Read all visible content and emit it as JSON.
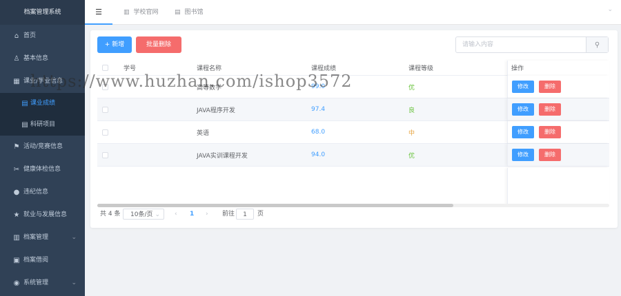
{
  "app": {
    "title": "档案管理系统"
  },
  "sidebar": {
    "items": [
      {
        "icon": "home-icon",
        "glyph": "⌂",
        "label": "首页",
        "chevron": ""
      },
      {
        "icon": "user-icon",
        "glyph": "♙",
        "label": "基本信息",
        "chevron": ""
      },
      {
        "icon": "grid-icon",
        "glyph": "▦",
        "label": "课业/学业信息",
        "chevron": ""
      },
      {
        "icon": "document-icon",
        "glyph": "▤",
        "label": "课业成绩",
        "chevron": "",
        "sub": true,
        "active": true
      },
      {
        "icon": "document-icon",
        "glyph": "▤",
        "label": "科研项目",
        "chevron": "",
        "sub": true
      },
      {
        "icon": "flag-icon",
        "glyph": "⚑",
        "label": "活动/竞赛信息",
        "chevron": ""
      },
      {
        "icon": "scissors-icon",
        "glyph": "✂",
        "label": "健康体检信息",
        "chevron": ""
      },
      {
        "icon": "info-icon",
        "glyph": "●",
        "label": "违纪信息",
        "chevron": ""
      },
      {
        "icon": "star-icon",
        "glyph": "★",
        "label": "就业与发展信息",
        "chevron": ""
      },
      {
        "icon": "chart-icon",
        "glyph": "▥",
        "label": "档案管理",
        "chevron": "⌄"
      },
      {
        "icon": "archive-icon",
        "glyph": "▣",
        "label": "档案借阅",
        "chevron": ""
      },
      {
        "icon": "location-icon",
        "glyph": "◉",
        "label": "系统管理",
        "chevron": "⌄"
      }
    ]
  },
  "header": {
    "menu_glyph": "☰",
    "links": [
      {
        "label": "学校官网",
        "glyph": "▥"
      },
      {
        "label": "图书馆",
        "glyph": "▤"
      }
    ],
    "chevron": "⌄"
  },
  "toolbar": {
    "add_label": "+ 新增",
    "batch_delete_label": "批量删除",
    "search_placeholder": "请输入内容",
    "search_glyph": "⚲"
  },
  "table": {
    "headers": {
      "id": "学号",
      "course": "课程名称",
      "score": "课程成绩",
      "grade": "课程等级",
      "ops": "操作"
    },
    "rows": [
      {
        "id": "",
        "course": "高等数学",
        "score": "99.0",
        "grade": "优",
        "grade_color": "#67c23a"
      },
      {
        "id": "",
        "course": "JAVA程序开发",
        "score": "97.4",
        "grade": "良",
        "grade_color": "#67c23a"
      },
      {
        "id": "",
        "course": "英语",
        "score": "68.0",
        "grade": "中",
        "grade_color": "#e6a23c"
      },
      {
        "id": "",
        "course": "JAVA实训课程开发",
        "score": "94.0",
        "grade": "优",
        "grade_color": "#67c23a"
      }
    ],
    "edit_label": "修改",
    "delete_label": "删除"
  },
  "pagination": {
    "total": "共 4 条",
    "page_size": "10条/页",
    "prev": "‹",
    "current": "1",
    "next": "›",
    "goto_prefix": "前往",
    "goto_value": "1",
    "goto_suffix": "页",
    "chevron": "⌄"
  },
  "watermark": "https://www.huzhan.com/ishop3572",
  "colors": {
    "primary": "#409eff",
    "danger": "#f56c6c",
    "sidebar_bg": "#304156"
  }
}
